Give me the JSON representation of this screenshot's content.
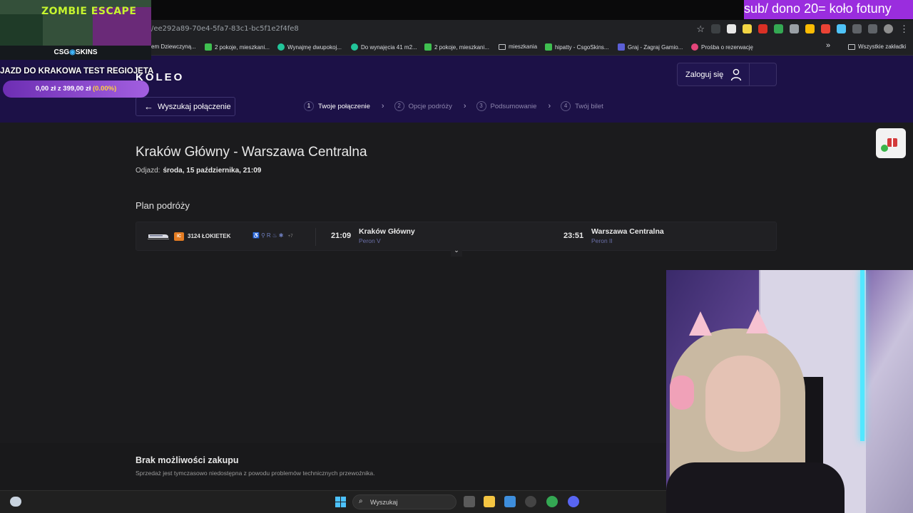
{
  "browser": {
    "url": "/ee292a89-70e4-5fa7-83c1-bc5f1e2f4fe8",
    "bookmarks": [
      "em Dziewczyną...",
      "2 pokoje, mieszkani...",
      "Wynajmę dwupokoj...",
      "Do wynajęcia 41 m2...",
      "2 pokoje, mieszkani...",
      "mieszkania",
      "hipatty - CsgoSkins...",
      "Graj - Zagraj Gamio...",
      "Prośba o rezerwację"
    ],
    "bookmarks_more": "»",
    "all_bookmarks": "Wszystkie zakładki"
  },
  "header": {
    "logo": "KOLEO",
    "login_label": "Zaloguj się",
    "back_label": "Wyszukaj połączenie",
    "steps": [
      {
        "num": "1",
        "label": "Twoje połączenie"
      },
      {
        "num": "2",
        "label": "Opcje podróży"
      },
      {
        "num": "3",
        "label": "Podsumowanie"
      },
      {
        "num": "4",
        "label": "Twój bilet"
      }
    ]
  },
  "trip": {
    "title": "Kraków Główny - Warszawa Centralna",
    "departure_label": "Odjazd:",
    "departure_value": "środa, 15 października, 21:09",
    "plan_title": "Plan podróży",
    "carrier": "IC",
    "train_number": "3124 ŁOKIETEK",
    "amenities_more": "+7",
    "dep_time": "21:09",
    "dep_station": "Kraków Główny",
    "dep_platform": "Peron V",
    "arr_time": "23:51",
    "arr_station": "Warszawa Centralna",
    "arr_platform": "Peron II"
  },
  "notice": {
    "title": "Brak możliwości zakupu",
    "text": "Sprzedaż jest tymczasowo niedostępna z powodu problemów technicznych przewoźnika."
  },
  "taskbar": {
    "search_label": "Wyszukaj"
  },
  "stream": {
    "game_title": "ZOMBIE ESCAPE",
    "brand_left": "CSG",
    "brand_right": "SKINS",
    "goal_title": "JAZD DO KRAKOWA TEST REGIOJETA",
    "goal_current": "0,00 zł",
    "goal_sep": "z",
    "goal_target": "399,00 zł",
    "goal_percent": "(0.00%)",
    "banner": "sub/ dono 20= koło fotuny"
  },
  "colors": {
    "header_bg": "#1c1147",
    "page_bg": "#1b1b1d",
    "carrier_badge": "#e47c22",
    "platform_text": "#6a6fa8",
    "banner_bg": "#9a2dde"
  }
}
